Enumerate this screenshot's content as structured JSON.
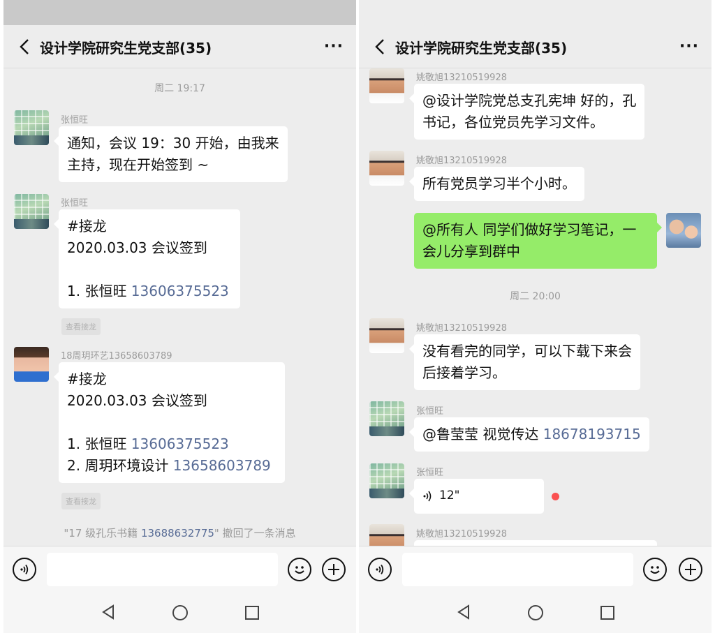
{
  "left": {
    "title": "设计学院研究生党支部(35)",
    "more": "···",
    "time": "周二 19:17",
    "messages": [
      {
        "sender": "张恒旺",
        "lines": [
          "通知，会议 19：30 开始，由我来",
          "主持，现在开始签到 ~"
        ]
      },
      {
        "sender": "张恒旺",
        "tag": "#接龙",
        "date": "2020.03.03 会议签到",
        "entry1": "1. 张恒旺 ",
        "phone1": "13606375523",
        "chip": "查看接龙"
      },
      {
        "sender": "18周玥环艺13658603789",
        "tag": "#接龙",
        "date": "2020.03.03 会议签到",
        "entry1": "1. 张恒旺 ",
        "phone1": "13606375523",
        "entry2": "2. 周玥环境设计 ",
        "phone2": "13658603789",
        "chip": "查看接龙"
      }
    ],
    "system": {
      "pre": "\"17 级孔乐书籍 ",
      "phone": "13688632775",
      "post": "\" 撤回了一条消息"
    }
  },
  "right": {
    "title": "设计学院研究生党支部(35)",
    "more": "···",
    "time": "周二 20:00",
    "messages": [
      {
        "sender": "姚敬旭13210519928",
        "lines": [
          "@设计学院党总支孔宪坤  好的，孔",
          "书记，各位党员先学习文件。"
        ]
      },
      {
        "sender": "姚敬旭13210519928",
        "lines": [
          "所有党员学习半个小时。"
        ]
      },
      {
        "lines": [
          "@所有人 同学们做好学习笔记，一",
          "会儿分享到群中"
        ]
      },
      {
        "sender": "姚敬旭13210519928",
        "lines": [
          "没有看完的同学，可以下载下来会",
          "后接着学习。"
        ]
      },
      {
        "sender": "张恒旺",
        "mention": "@鲁莹莹 视觉传达 ",
        "phone": "18678193715"
      },
      {
        "sender": "张恒旺",
        "voice": "12\""
      },
      {
        "sender": "姚敬旭13210519928"
      }
    ]
  },
  "icons": {
    "voice_button": "voice-icon",
    "emoji_button": "emoji-icon",
    "add_button": "plus-icon"
  },
  "colors": {
    "chat_bg": "#ededed",
    "own_bubble": "#95ec69",
    "phone_link": "#576b95",
    "unread": "#fa5151"
  }
}
